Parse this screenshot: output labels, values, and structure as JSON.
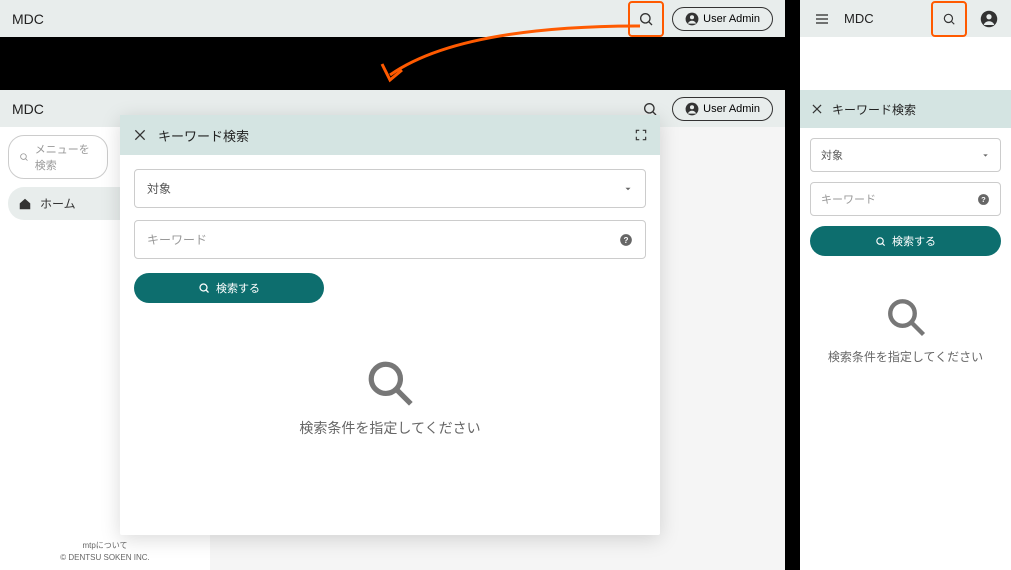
{
  "brand": "MDC",
  "user_button_label": "User Admin",
  "sidebar": {
    "menu_search_placeholder": "メニューを検索",
    "home_label": "ホーム",
    "footer_link": "mtpについて",
    "copyright": "© DENTSU SOKEN INC."
  },
  "modal": {
    "title": "キーワード検索",
    "target_label": "対象",
    "keyword_placeholder": "キーワード",
    "search_button_label": "検索する",
    "empty_message": "検索条件を指定してください"
  },
  "colors": {
    "highlight": "#ff5a00",
    "teal": "#0d6e6e",
    "header_bg": "#e8edec",
    "modal_header_bg": "#d4e4e2"
  }
}
